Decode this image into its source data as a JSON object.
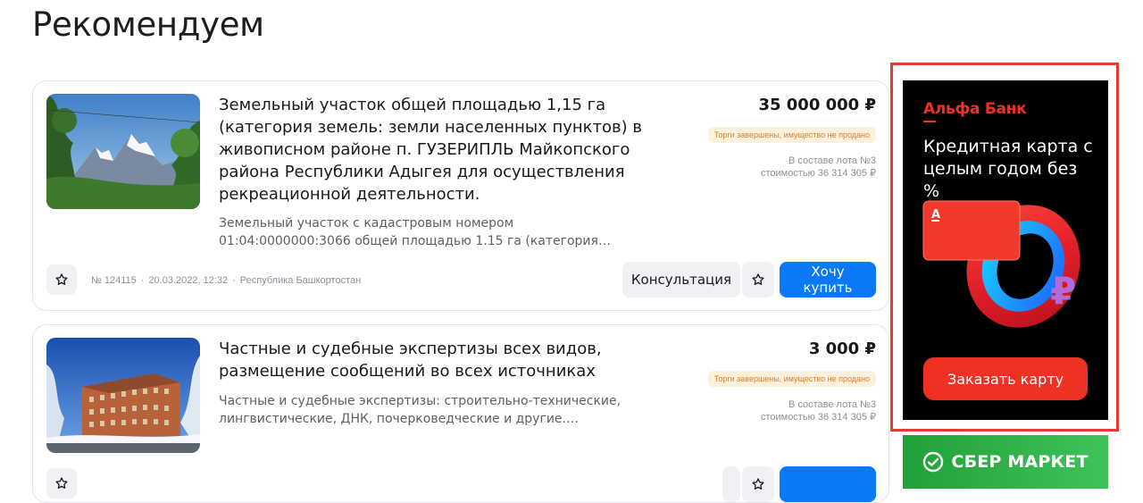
{
  "section": {
    "title": "Рекомендуем"
  },
  "listings": [
    {
      "title": "Земельный участок общей площадью 1,15 га (категория земель: земли населенных пунктов) в живописном районе п. ГУЗЕРИПЛЬ Майкопского района Республики Адыгея для осуществления рекреационной деятельности.",
      "description": "Земельный участок с кадастровым номером 01:04:0000000:3066 общей площадью 1.15 га (категория земель: земли населенных пунктов) в живописном районе п. ГУЗЕРИПЛЬ",
      "price": "35 000 000 ₽",
      "status": "Торги завершены, имущество не продано",
      "lot_line1": "В составе лота №3",
      "lot_line2": "стоимостью 36 314 305 ₽",
      "id": "№ 124115",
      "date": "20.03.2022, 12:32",
      "region": "Республика Башкортостан",
      "meta_sep": "·",
      "consult_label": "Консультация",
      "buy_label": "Хочу купить",
      "image_icon": "mountain-landscape-photo"
    },
    {
      "title": "Частные и судебные экспертизы всех видов, размещение сообщений во всех источниках",
      "description": "Частные и судебные экспертизы: строительно-технические, лингвистические, ДНК, почерковедческие и другие. Размещение сообщений во всех источниках",
      "price": "3 000 ₽",
      "status": "Торги завершены, имущество не продано",
      "lot_line1": "В составе лота №3",
      "lot_line2": "стоимостью 36 314 305 ₽",
      "image_icon": "winter-building-photo"
    }
  ],
  "ad": {
    "brand": "Альфа Банк",
    "headline": "Кредитная карта с целым годом без %",
    "cta": "Заказать карту",
    "accent": "#ef3124",
    "frame_color": "#e53a2f",
    "art_icon": "credit-card-ring-ruble"
  },
  "ad2": {
    "brand": "СБЕР МАРКЕТ",
    "color": "#21a038",
    "logo_icon": "check-circle-icon"
  },
  "colors": {
    "buy_button": "#0b78f5",
    "status_bg": "#fdf0dc",
    "status_text": "#d9822b"
  }
}
